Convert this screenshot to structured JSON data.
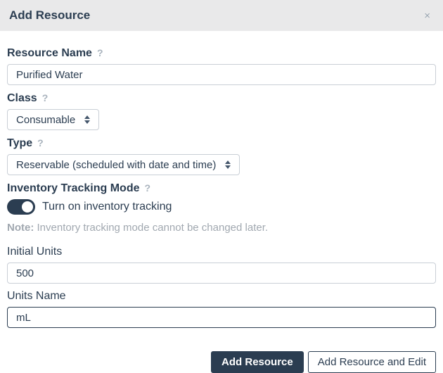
{
  "modal": {
    "title": "Add Resource",
    "close_label": "×"
  },
  "fields": {
    "resource_name": {
      "label": "Resource Name",
      "help": "?",
      "value": "Purified Water"
    },
    "resource_class": {
      "label": "Class",
      "help": "?",
      "selected": "Consumable"
    },
    "resource_type": {
      "label": "Type",
      "help": "?",
      "selected": "Reservable (scheduled with date and time)"
    },
    "inventory_tracking": {
      "label": "Inventory Tracking Mode",
      "help": "?",
      "toggle_label": "Turn on inventory tracking",
      "toggle_on": true,
      "note_prefix": "Note:",
      "note_text": " Inventory tracking mode cannot be changed later."
    },
    "initial_units": {
      "label": "Initial Units",
      "value": "500"
    },
    "units_name": {
      "label": "Units Name",
      "value": "mL"
    }
  },
  "footer": {
    "primary_button": "Add Resource",
    "secondary_button": "Add Resource and Edit"
  },
  "colors": {
    "navy": "#2b3d51",
    "header_bg": "#e9e9ea",
    "help_gray": "#a9b3bd",
    "input_border_gray": "#c9cfd6",
    "note_gray": "#a1a8b0"
  }
}
